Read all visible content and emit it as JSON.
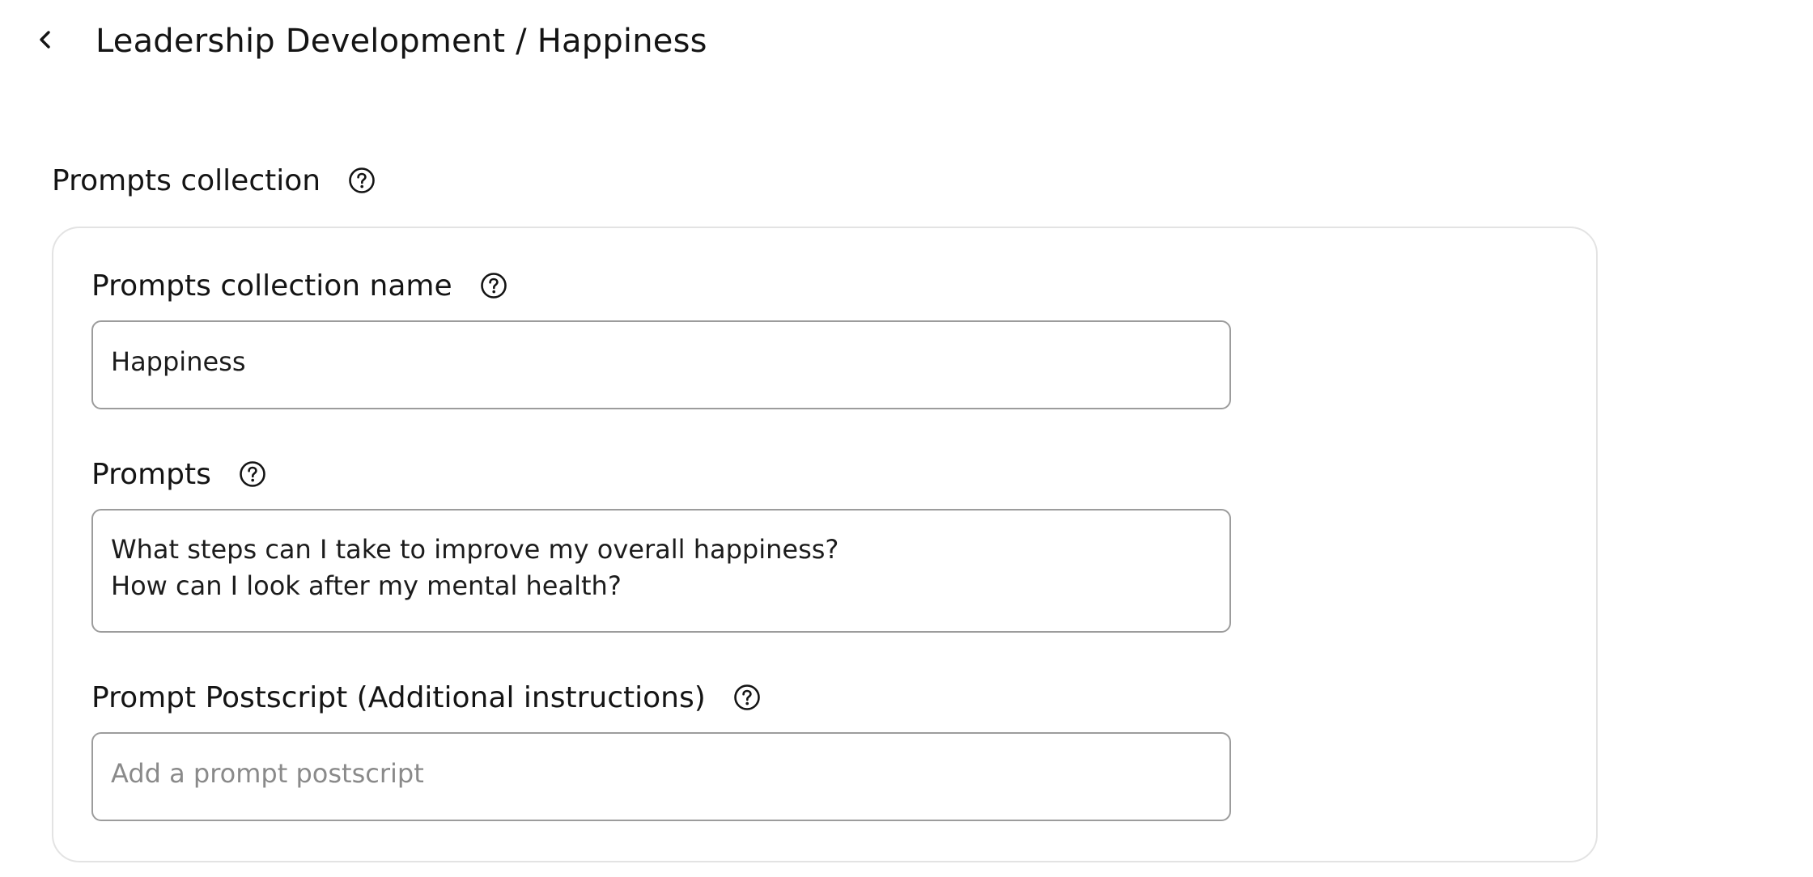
{
  "header": {
    "back_icon": "chevron-left-icon",
    "title": "Leadership Development / Happiness"
  },
  "section": {
    "title": "Prompts collection",
    "help_icon": "question-circle-icon"
  },
  "form": {
    "collection_name": {
      "label": "Prompts collection name",
      "value": "Happiness"
    },
    "prompts": {
      "label": "Prompts",
      "lines": [
        "What steps can I take to improve my overall happiness?",
        "How can I look after my mental health?"
      ]
    },
    "postscript": {
      "label": "Prompt Postscript (Additional instructions)",
      "value": "",
      "placeholder": "Add a prompt postscript"
    }
  },
  "colors": {
    "text": "#141414",
    "input_border": "#9c9c9c",
    "card_border": "#e3e3e3",
    "placeholder": "#8a8a8a"
  }
}
